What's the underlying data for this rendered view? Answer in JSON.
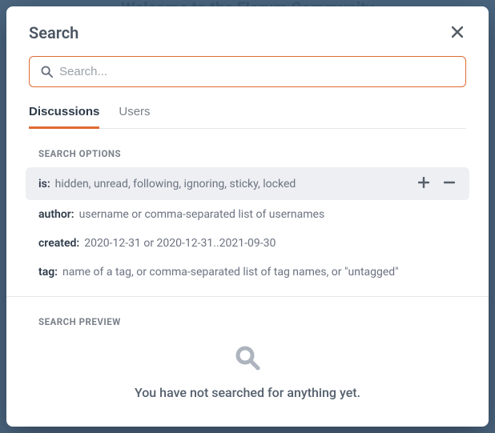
{
  "background_title": "Welcome to the Flarum Community",
  "modal": {
    "title": "Search",
    "search_placeholder": "Search..."
  },
  "tabs": {
    "discussions": "Discussions",
    "users": "Users",
    "active": "discussions"
  },
  "headings": {
    "options": "SEARCH OPTIONS",
    "preview": "SEARCH PREVIEW"
  },
  "options": [
    {
      "key": "is:",
      "value": "hidden, unread, following, ignoring, sticky, locked",
      "highlighted": true,
      "has_controls": true
    },
    {
      "key": "author:",
      "value": "username or comma-separated list of usernames"
    },
    {
      "key": "created:",
      "value": "2020-12-31 or 2020-12-31..2021-09-30"
    },
    {
      "key": "tag:",
      "value": "name of a tag, or comma-separated list of tag names, or \"untagged\""
    }
  ],
  "preview": {
    "empty_text": "You have not searched for anything yet."
  },
  "colors": {
    "accent": "#e06b34"
  }
}
